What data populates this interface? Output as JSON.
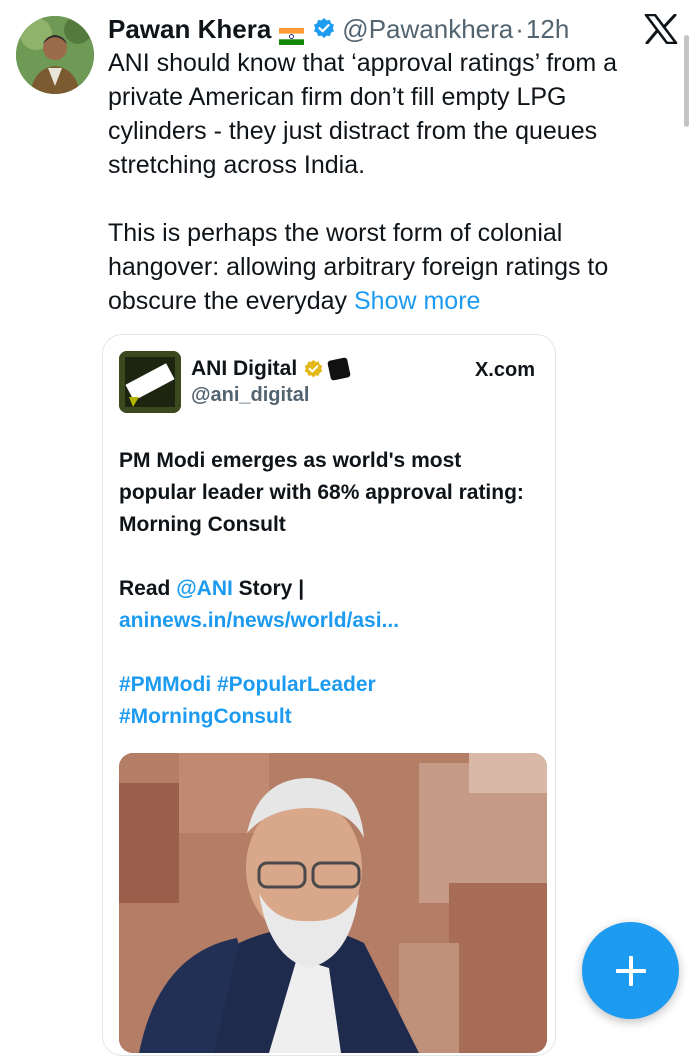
{
  "tweet": {
    "author_name": "Pawan Khera",
    "author_handle": "@Pawankhera",
    "separator": "·",
    "time": "12h",
    "text_para1": "ANI should know that ‘approval ratings’ from a private American firm don’t fill empty LPG cylinders - they just distract from the queues stretching across India.",
    "text_para2": "This is perhaps the worst form of colonial hangover: allowing arbitrary foreign ratings to obscure the everyday ",
    "show_more": "Show more"
  },
  "quoted": {
    "name": "ANI Digital",
    "handle": "@ani_digital",
    "source": "X.com",
    "headline": "PM Modi emerges as world's most popular leader with 68% approval rating: Morning Consult",
    "read_prefix": "Read ",
    "read_mention": "@ANI",
    "read_middle": " Story | ",
    "read_link": "aninews.in/news/world/asi...",
    "hashtags": "#PMModi #PopularLeader #MorningConsult"
  },
  "icons": {
    "flag": "india-flag-icon",
    "verified": "verified-badge-icon",
    "x_logo": "x-logo-icon",
    "gold_check": "gold-verified-icon",
    "compose": "plus-icon"
  },
  "colors": {
    "link_blue": "#1d9bf0",
    "secondary_text": "#536471",
    "primary_text": "#0f1419"
  }
}
